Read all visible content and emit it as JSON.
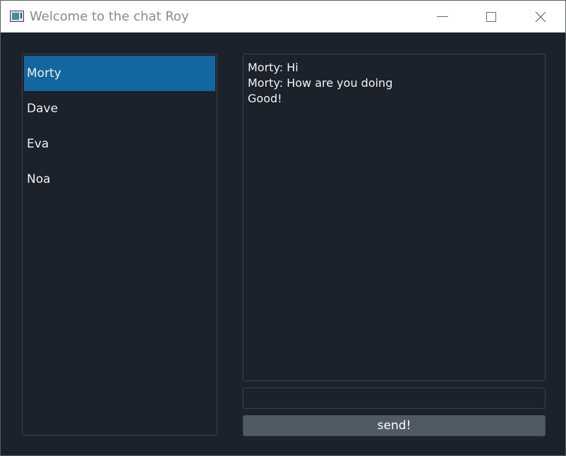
{
  "window": {
    "title": "Welcome to the chat Roy",
    "controls": [
      "minimize-icon",
      "maximize-icon",
      "close-icon"
    ],
    "close_glyph": "✕"
  },
  "contacts": {
    "items": [
      {
        "label": "Morty",
        "selected": true
      },
      {
        "label": "Dave",
        "selected": false
      },
      {
        "label": "Eva",
        "selected": false
      },
      {
        "label": "Noa",
        "selected": false
      }
    ]
  },
  "chat": {
    "messages": [
      "Morty: Hi",
      "Morty: How are you doing",
      "Good!"
    ]
  },
  "input": {
    "value": "",
    "placeholder": ""
  },
  "send": {
    "label": "send!"
  },
  "colors": {
    "background": "#1b222b",
    "selection": "#1466a1",
    "send_button": "#505a64",
    "titlebar": "#ffffff"
  }
}
